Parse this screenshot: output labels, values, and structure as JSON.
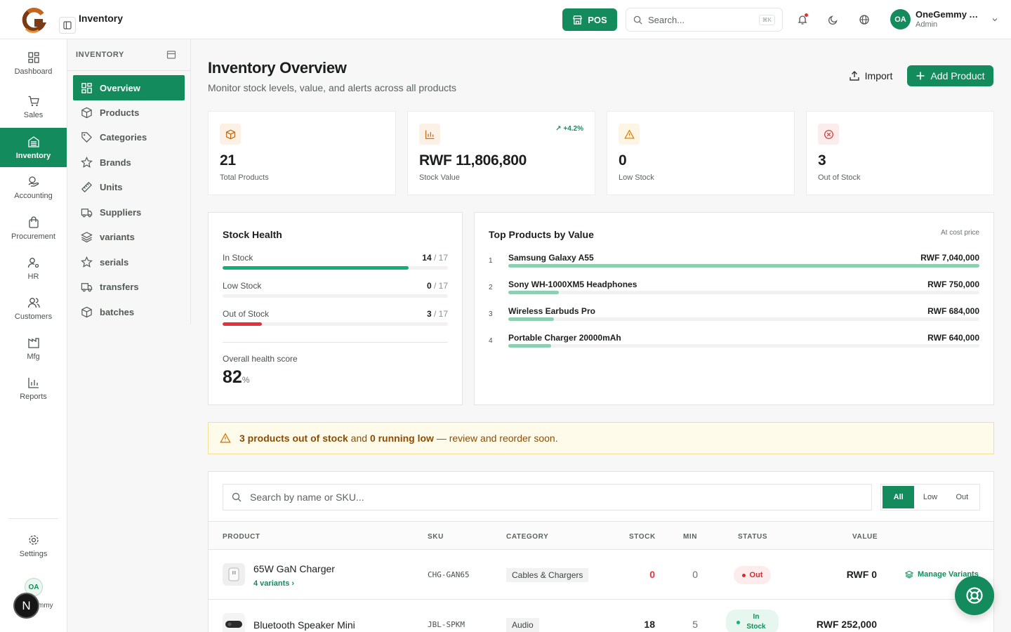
{
  "header": {
    "app_title": "Inventory",
    "pos_label": "POS",
    "search_placeholder": "Search...",
    "search_shortcut": "⌘K",
    "user": {
      "initials": "OA",
      "name": "OneGemmy A...",
      "role": "Admin"
    }
  },
  "rail": {
    "items": [
      {
        "label": "Dashboard",
        "icon": "dashboard-icon"
      },
      {
        "label": "Sales",
        "icon": "cart-icon"
      },
      {
        "label": "Inventory",
        "icon": "inventory-icon",
        "active": true
      },
      {
        "label": "Accounting",
        "icon": "coins-icon"
      },
      {
        "label": "Procurement",
        "icon": "bag-icon"
      },
      {
        "label": "HR",
        "icon": "user-cog-icon"
      },
      {
        "label": "Customers",
        "icon": "users-icon"
      },
      {
        "label": "Mfg",
        "icon": "factory-icon"
      },
      {
        "label": "Reports",
        "icon": "bar-chart-icon"
      }
    ],
    "settings_label": "Settings",
    "user_initials": "OA",
    "user_name_fragment": "mmy",
    "n_badge": "N"
  },
  "subnav": {
    "title": "INVENTORY",
    "items": [
      {
        "label": "Overview",
        "icon": "grid-icon",
        "active": true
      },
      {
        "label": "Products",
        "icon": "box-icon"
      },
      {
        "label": "Categories",
        "icon": "tag-icon"
      },
      {
        "label": "Brands",
        "icon": "star-icon"
      },
      {
        "label": "Units",
        "icon": "ruler-icon"
      },
      {
        "label": "Suppliers",
        "icon": "truck-icon"
      },
      {
        "label": "variants",
        "icon": "layers-icon"
      },
      {
        "label": "serials",
        "icon": "star-icon"
      },
      {
        "label": "transfers",
        "icon": "truck-icon"
      },
      {
        "label": "batches",
        "icon": "box-icon"
      }
    ]
  },
  "main": {
    "title": "Inventory Overview",
    "subtitle": "Monitor stock levels, value, and alerts across all products",
    "import_label": "Import",
    "add_label": "Add Product"
  },
  "stats": [
    {
      "value": "21",
      "label": "Total Products",
      "icon": "box-icon",
      "color": "#c2620a",
      "bg": "#fdf1e6"
    },
    {
      "value": "RWF 11,806,800",
      "label": "Stock Value",
      "icon": "bar-chart-icon",
      "color": "#c2620a",
      "bg": "#fdf1e6",
      "trend": "+4.2%"
    },
    {
      "value": "0",
      "label": "Low Stock",
      "icon": "warning-icon",
      "color": "#d97706",
      "bg": "#fef6e4"
    },
    {
      "value": "3",
      "label": "Out of Stock",
      "icon": "x-circle-icon",
      "color": "#d92b2b",
      "bg": "#fdecec"
    }
  ],
  "stock_health": {
    "title": "Stock Health",
    "total": "17",
    "rows": [
      {
        "label": "In Stock",
        "count": "14",
        "fraction": 0.824,
        "color": "#12b076"
      },
      {
        "label": "Low Stock",
        "count": "0",
        "fraction": 0,
        "color": "#f0b429"
      },
      {
        "label": "Out of Stock",
        "count": "3",
        "fraction": 0.176,
        "color": "#e5313f"
      }
    ],
    "score_label": "Overall health score",
    "score": "82",
    "score_unit": "%"
  },
  "top_products": {
    "title": "Top Products by Value",
    "note": "At cost price",
    "items": [
      {
        "rank": "1",
        "name": "Samsung Galaxy A55",
        "value": "RWF 7,040,000",
        "fraction": 1.0
      },
      {
        "rank": "2",
        "name": "Sony WH-1000XM5 Headphones",
        "value": "RWF 750,000",
        "fraction": 0.107
      },
      {
        "rank": "3",
        "name": "Wireless Earbuds Pro",
        "value": "RWF 684,000",
        "fraction": 0.097
      },
      {
        "rank": "4",
        "name": "Portable Charger 20000mAh",
        "value": "RWF 640,000",
        "fraction": 0.091
      }
    ]
  },
  "alert": {
    "part1": "3 products out of stock",
    "part2": " and ",
    "part3": "0 running low",
    "part4": " — review and reorder soon."
  },
  "table": {
    "search_placeholder": "Search by name or SKU...",
    "filters": [
      "All",
      "Low",
      "Out"
    ],
    "headers": [
      "PRODUCT",
      "SKU",
      "CATEGORY",
      "STOCK",
      "MIN",
      "STATUS",
      "VALUE"
    ],
    "rows": [
      {
        "name": "65W GaN Charger",
        "variants": "4 variants ›",
        "sku": "CHG-GAN65",
        "category": "Cables & Chargers",
        "stock": "0",
        "min": "0",
        "status": "Out",
        "value": "RWF 0",
        "action": "Manage Variants"
      },
      {
        "name": "Bluetooth Speaker Mini",
        "sku": "JBL-SPKM",
        "category": "Audio",
        "stock": "18",
        "min": "5",
        "status": "In Stock",
        "value": "RWF 252,000"
      }
    ]
  },
  "colors": {
    "brand": "#148b5c",
    "danger": "#e5313f",
    "warning": "#f0b429"
  }
}
